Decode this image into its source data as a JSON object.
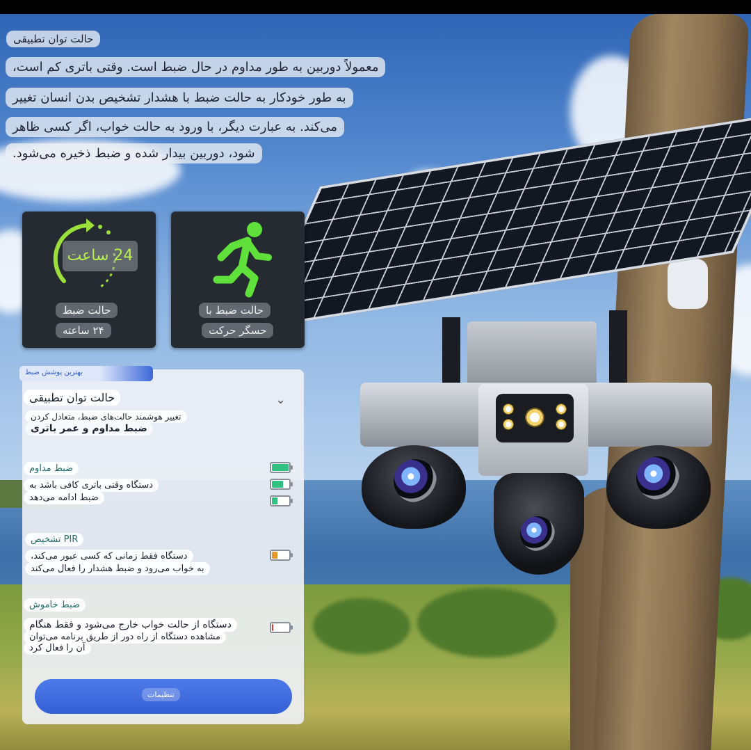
{
  "intro": {
    "title": "حالت توان تطبیقی",
    "lines": [
      "معمولاً دوربین به طور مداوم در حال ضبط است. وقتی باتری کم است،",
      "به طور خودکار به حالت ضبط با هشدار تشخیص بدن انسان تغییر",
      "می‌کند. به عبارت دیگر، با ورود به حالت خواب، اگر کسی ظاهر",
      "شود، دوربین بیدار شده و ضبط ذخیره می‌شود."
    ]
  },
  "cards": [
    {
      "badge": "24 ساعت",
      "caption1": "حالت ضبط",
      "caption2": "۲۴ ساعته",
      "icon": "clock-24h-icon",
      "accent": "#9be03a"
    },
    {
      "caption1": "حالت ضبط با",
      "caption2": "حسگر حرکت",
      "icon": "running-person-icon",
      "accent": "#5fe03a"
    }
  ],
  "settings": {
    "tag": "بهترین پوشش ضبط",
    "header_title": "حالت توان تطبیقی",
    "header_sub": "تغییر هوشمند حالت‌های ضبط، متعادل کردن",
    "header_sub2": "ضبط مداوم و عمر باتری",
    "sections": [
      {
        "title": "ضبط مداوم",
        "line1": "دستگاه وقتی باتری کافی باشد به",
        "line2": "ضبط ادامه می‌دهد"
      },
      {
        "title": "PIR تشخیص",
        "line1": "دستگاه فقط زمانی که کسی عبور می‌کند،",
        "line2": "به خواب می‌رود و ضبط هشدار را فعال می‌کند"
      },
      {
        "title": "ضبط خاموش",
        "line1": "دستگاه از حالت خواب خارج می‌شود و فقط هنگام",
        "line2": "مشاهده دستگاه از راه دور از طریق برنامه می‌توان",
        "line3": "آن را فعال کرد"
      }
    ],
    "battery_levels": [
      1.0,
      0.66,
      0.33,
      0.33,
      0.1
    ],
    "battery_colors": {
      "green": "#2ec27e",
      "orange": "#e59a2a",
      "red": "#e0392f"
    },
    "button_label": "تنظیمات"
  }
}
